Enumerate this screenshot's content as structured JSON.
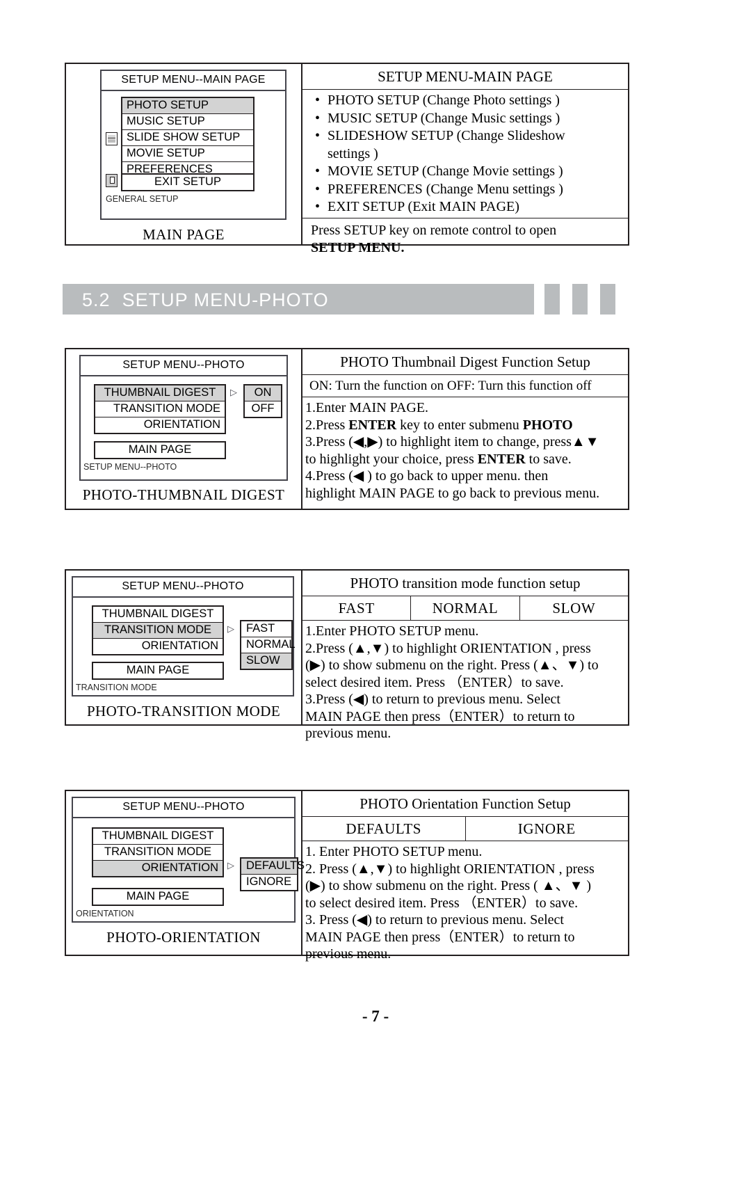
{
  "section": {
    "number": "5.2",
    "title": "SETUP MENU-PHOTO"
  },
  "page_number": "- 7 -",
  "blocks": [
    {
      "osd": {
        "title": "SETUP MENU--MAIN PAGE",
        "menu_items": [
          "PHOTO SETUP",
          "MUSIC SETUP",
          "SLIDE SHOW SETUP",
          "MOVIE SETUP",
          "PREFERENCES"
        ],
        "selected_item": "PHOTO SETUP",
        "exit_item": "EXIT SETUP",
        "footnote": "GENERAL SETUP"
      },
      "caption": "MAIN PAGE",
      "right": {
        "head": "SETUP MENU-MAIN PAGE",
        "bullets": [
          "PHOTO SETUP (Change Photo settings )",
          "MUSIC SETUP (Change Music settings )",
          "SLIDESHOW SETUP (Change Slideshow",
          "settings )",
          "MOVIE SETUP (Change Movie settings )",
          "PREFERENCES (Change Menu settings )",
          "EXIT SETUP (Exit MAIN PAGE)"
        ],
        "foot": [
          "Press SETUP key on remote control to open",
          "SETUP MENU."
        ]
      }
    },
    {
      "osd": {
        "title": "SETUP MENU--PHOTO",
        "menu_items": [
          "THUMBNAIL DIGEST",
          "TRANSITION MODE",
          "ORIENTATION"
        ],
        "selected_item": "THUMBNAIL DIGEST",
        "submenu": [
          "ON",
          "OFF"
        ],
        "submenu_selected": "ON",
        "main_page_item": "MAIN PAGE",
        "footnote": "SETUP MENU--PHOTO"
      },
      "caption": "PHOTO-THUMBNAIL DIGEST",
      "right": {
        "head": "PHOTO Thumbnail Digest Function Setup",
        "sub": "ON: Turn the function on   OFF: Turn this function off",
        "body": [
          "1.Enter MAIN PAGE.",
          "2.Press <b>ENTER</b> key to enter submenu <b>PHOTO</b>",
          "3.Press (◀,▶) to highlight item to change, press▲▼",
          "to highlight your choice,  press <b>ENTER</b> to save.",
          "4.Press (◀ ) to go back to upper menu. then",
          "highlight MAIN PAGE to go back to previous menu."
        ]
      }
    },
    {
      "osd": {
        "title": "SETUP MENU--PHOTO",
        "menu_items": [
          "THUMBNAIL DIGEST",
          "TRANSITION MODE",
          "ORIENTATION"
        ],
        "selected_item": "TRANSITION MODE",
        "submenu": [
          "FAST",
          "NORMAL",
          "SLOW"
        ],
        "submenu_selected": "SLOW",
        "main_page_item": "MAIN PAGE",
        "footnote": "TRANSITION MODE"
      },
      "caption": "PHOTO-TRANSITION MODE",
      "right": {
        "head": "PHOTO transition mode function setup",
        "options": [
          "FAST",
          "NORMAL",
          "SLOW"
        ],
        "body": [
          "1.Enter PHOTO SETUP  menu.",
          "2.Press (▲,▼) to highlight ORIENTATION , press",
          " (▶) to show submenu on the right. Press (▲、▼) to",
          "   select desired item. Press （ENTER）to save.",
          "3.Press (◀)  to return to previous menu. Select",
          "    MAIN PAGE then press（ENTER）to return to",
          "    previous menu."
        ]
      }
    },
    {
      "osd": {
        "title": "SETUP MENU--PHOTO",
        "menu_items": [
          "THUMBNAIL DIGEST",
          "TRANSITION MODE",
          "ORIENTATION"
        ],
        "selected_item": "ORIENTATION",
        "submenu": [
          "DEFAULTS",
          "IGNORE"
        ],
        "submenu_selected": "DEFAULTS",
        "main_page_item": "MAIN PAGE",
        "footnote": "ORIENTATION"
      },
      "caption": "PHOTO-ORIENTATION",
      "right": {
        "head": "PHOTO Orientation Function Setup",
        "options": [
          "DEFAULTS",
          "IGNORE"
        ],
        "body": [
          "1. Enter PHOTO SETUP menu.",
          "2. Press (▲,▼) to highlight ORIENTATION , press",
          "  (▶) to show submenu on the right. Press ( ▲、▼ )",
          "   to select desired item. Press （ENTER）to save.",
          "3. Press (◀)  to return to previous menu. Select",
          "     MAIN PAGE then press（ENTER）to return to",
          "     previous menu."
        ]
      }
    }
  ]
}
